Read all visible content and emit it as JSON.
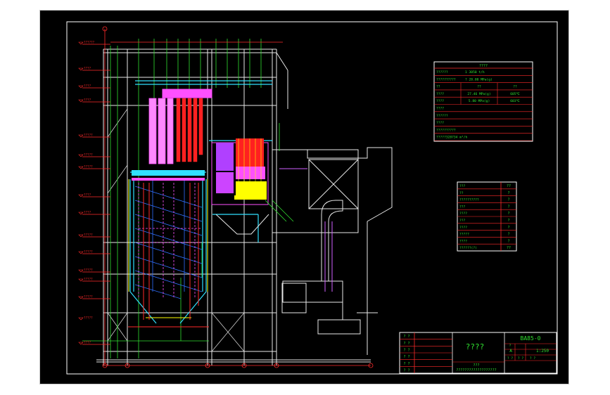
{
  "title_block": {
    "drawing_no": "BA85-0",
    "placeholder_title": "????",
    "scale": "1:250",
    "sheet": "A",
    "left_labels": [
      "? ?",
      "? ?",
      "? ?",
      "? ?",
      "? ?",
      "? ?"
    ],
    "project_line1": "???",
    "project_line2": "???????????????????",
    "small_cells": [
      "? ?",
      "? ?",
      "? ?",
      "?"
    ]
  },
  "spec_table": {
    "header": "????",
    "rows": [
      {
        "c1": "??????",
        "c2": "1 3050 t/h",
        "c3": ""
      },
      {
        "c1": "??????????",
        "c2": "? 28.00 MPa(g)",
        "c3": ""
      },
      {
        "c1": "??",
        "c2": "??",
        "c3": "??"
      },
      {
        "c1": "????",
        "c2": "27.46 MPa(g)",
        "c3": "605℃"
      },
      {
        "c1": "????",
        "c2": "5.80 MPa(g)",
        "c3": "603℃"
      },
      {
        "c1": "????",
        "c2": "",
        "c3": ""
      },
      {
        "c1": "??????",
        "c2": "",
        "c3": ""
      },
      {
        "c1": "????",
        "c2": "",
        "c3": ""
      },
      {
        "c1": "??????????",
        "c2": "",
        "c3": ""
      },
      {
        "c1": "?????328734 m³/h",
        "c2": "",
        "c3": ""
      }
    ]
  },
  "legend_table": {
    "rows": [
      {
        "label": "???",
        "mark": "??"
      },
      {
        "label": "??",
        "mark": "?"
      },
      {
        "label": "??????????",
        "mark": "?"
      },
      {
        "label": "???",
        "mark": "?"
      },
      {
        "label": "????",
        "mark": "?"
      },
      {
        "label": "???",
        "mark": "?"
      },
      {
        "label": "????",
        "mark": "?"
      },
      {
        "label": "?????",
        "mark": "?"
      },
      {
        "label": "????",
        "mark": "?"
      },
      {
        "label": "??????(?)",
        "mark": "??"
      }
    ]
  },
  "elevation_marks": [
    "??????",
    "????",
    "????",
    "????",
    "?????",
    "?????",
    "?????",
    "????",
    "????",
    "?????",
    "?????",
    "?????",
    "?????",
    "?????",
    "?????",
    "????"
  ],
  "colors": {
    "frame": "#ffffff",
    "red": "#ff2a2a",
    "green": "#30e030",
    "cyan": "#30e0ff",
    "magenta": "#ff50ff",
    "yellow": "#ffff00",
    "blue": "#3060ff",
    "pink": "#ff88ff"
  }
}
